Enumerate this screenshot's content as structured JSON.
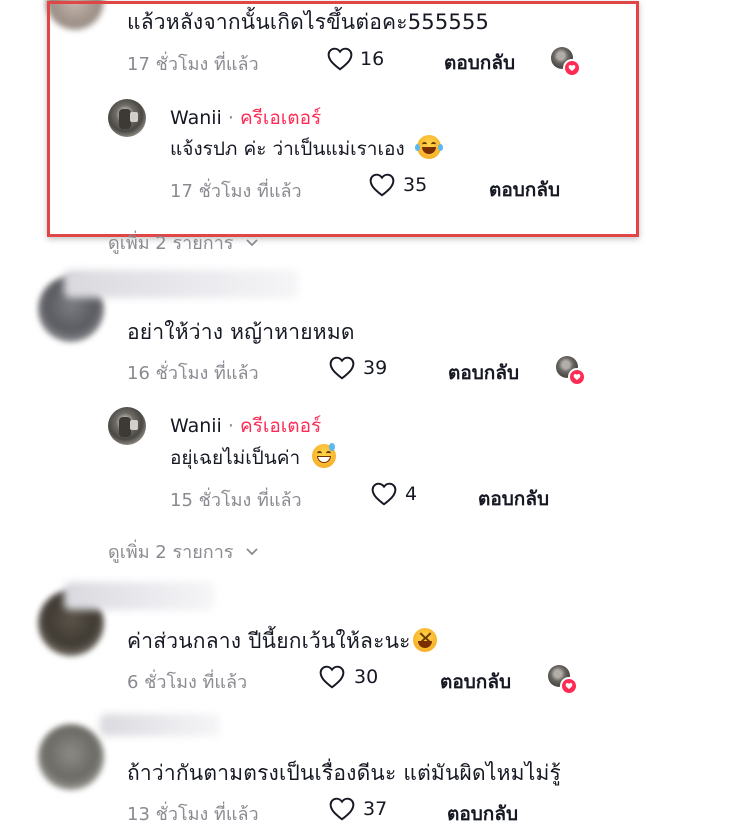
{
  "comments": [
    {
      "text": "แล้วหลังจากนั้นเกิดไรขึ้นต่อคะ555555",
      "time": "17 ชั่วโมง ที่แล้ว",
      "likes": "16",
      "reply_label": "ตอบกลับ",
      "reply": {
        "author": "Wanii",
        "separator": "·",
        "badge": "ครีเอเตอร์",
        "text": "แจ้งรปภ ค่ะ ว่าเป็นแม่เราเอง",
        "time": "17 ชั่วโมง ที่แล้ว",
        "likes": "35",
        "reply_label": "ตอบกลับ"
      },
      "view_more": "ดูเพิ่ม 2 รายการ"
    },
    {
      "text": "อย่าให้ว่าง หญ้าหายหมด",
      "time": "16 ชั่วโมง ที่แล้ว",
      "likes": "39",
      "reply_label": "ตอบกลับ",
      "reply": {
        "author": "Wanii",
        "separator": "·",
        "badge": "ครีเอเตอร์",
        "text": "อยุ่เฉยไม่เป็นค่า",
        "time": "15 ชั่วโมง ที่แล้ว",
        "likes": "4",
        "reply_label": "ตอบกลับ"
      },
      "view_more": "ดูเพิ่ม 2 รายการ"
    },
    {
      "text": "ค่าส่วนกลาง ปีนี้ยกเว้นให้ละนะ",
      "time": "6 ชั่วโมง ที่แล้ว",
      "likes": "30",
      "reply_label": "ตอบกลับ"
    },
    {
      "text": "ถ้าว่ากันตามตรงเป็นเรื่องดีนะ แต่มันผิดไหมไม่รู้",
      "time": "13 ชั่วโมง ที่แล้ว",
      "likes": "37",
      "reply_label": "ตอบกลับ"
    }
  ],
  "colors": {
    "creator_badge": "#fe2c55",
    "highlight_border": "#e04646",
    "meta_gray": "#8a8b91"
  }
}
